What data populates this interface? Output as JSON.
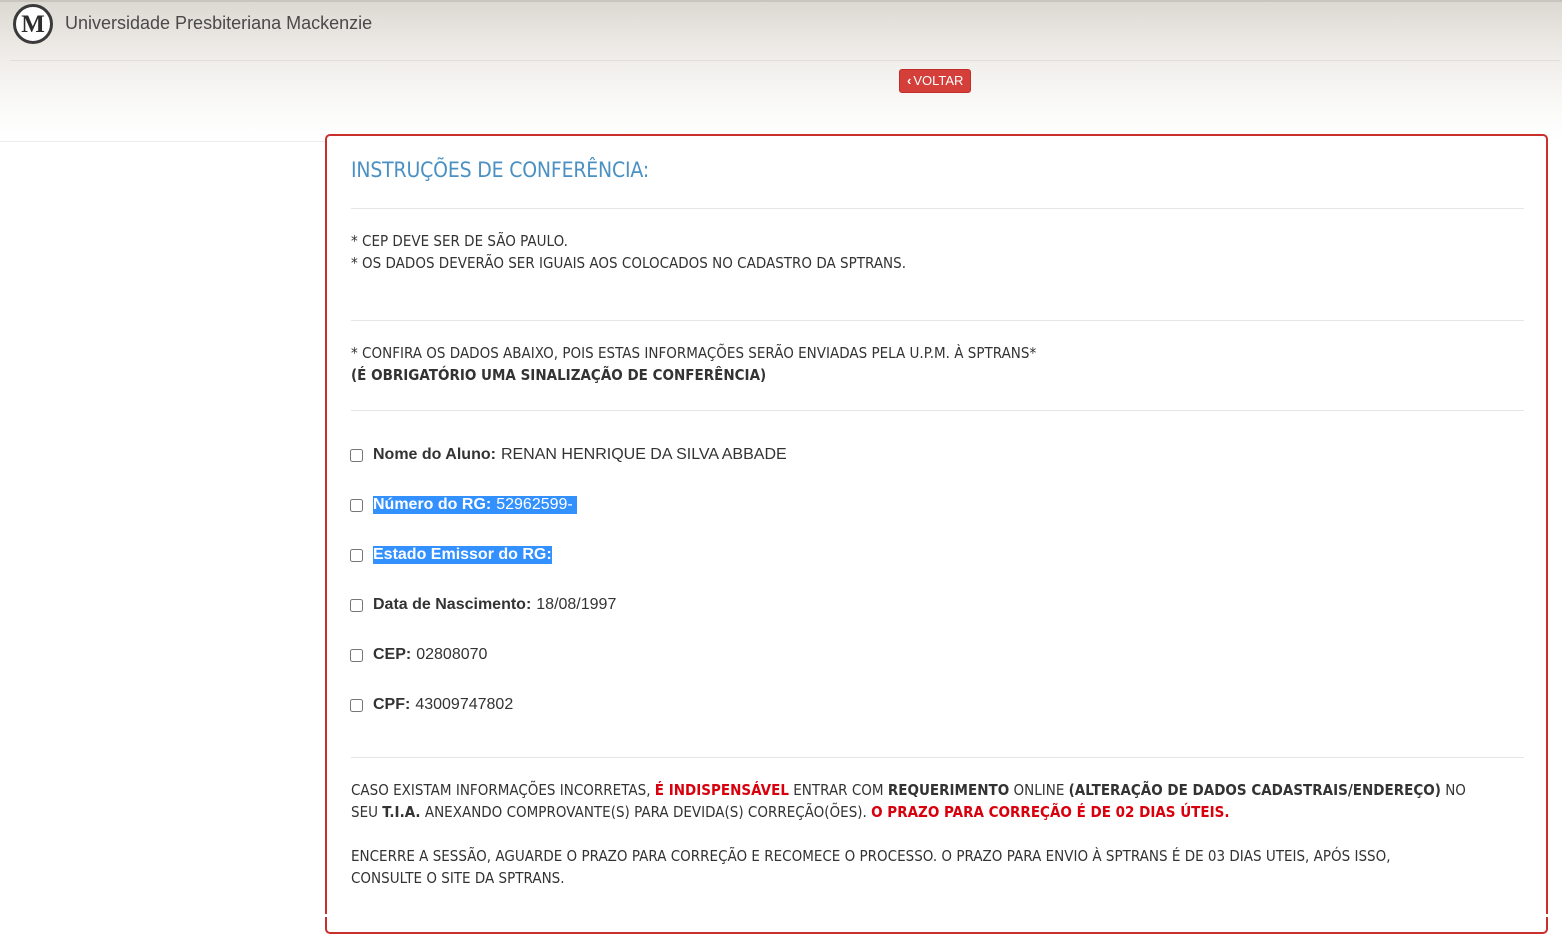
{
  "header": {
    "logo_letter": "M",
    "brand_name": "Universidade Presbiteriana Mackenzie",
    "back_label": "VOLTAR"
  },
  "panel": {
    "title": "INSTRUÇÕES DE CONFERÊNCIA:",
    "note1": "* CEP DEVE SER DE SÃO PAULO.",
    "note2": "* OS DADOS DEVERÃO SER IGUAIS AOS COLOCADOS NO CADASTRO DA SPTRANS.",
    "confirm_line": "* CONFIRA OS DADOS ABAIXO, POIS ESTAS INFORMAÇÕES SERÃO ENVIADAS PELA U.P.M. À SPTRANS*",
    "mandatory_line": "(É OBRIGATÓRIO UMA SINALIZAÇÃO DE CONFERÊNCIA)",
    "fields": [
      {
        "label": "Nome do Aluno:",
        "value": "RENAN HENRIQUE DA SILVA ABBADE"
      },
      {
        "label": "Número do RG:",
        "value": "52962599-"
      },
      {
        "label": "Estado Emissor do RG:",
        "value": ""
      },
      {
        "label": "Data de Nascimento:",
        "value": "18/08/1997"
      },
      {
        "label": "CEP:",
        "value": "02808070"
      },
      {
        "label": "CPF:",
        "value": "43009747802"
      }
    ],
    "warning": {
      "p1_a": "CASO EXISTAM INFORMAÇÕES INCORRETAS, ",
      "p1_b": "É INDISPENSÁVEL",
      "p1_c": " ENTRAR COM ",
      "p1_d": "REQUERIMENTO",
      "p1_e": " ONLINE ",
      "p1_f": "(ALTERAÇÃO DE DADOS CADASTRAIS/ENDEREÇO)",
      "p1_g": " NO",
      "p2_a": "SEU ",
      "p2_b": "T.I.A.",
      "p2_c": " ANEXANDO COMPROVANTE(S) PARA DEVIDA(S) CORREÇÃO(ÕES). ",
      "p2_d": "O PRAZO PARA CORREÇÃO É DE 02 DIAS ÚTEIS.",
      "p3": "ENCERRE A SESSÃO, AGUARDE O PRAZO PARA CORREÇÃO E RECOMECE O PROCESSO. O PRAZO PARA ENVIO À SPTRANS É DE 03 DIAS UTEIS, APÓS ISSO,",
      "p4": "CONSULTE O SITE DA SPTRANS."
    }
  },
  "colors": {
    "title_blue": "#4a90c2",
    "panel_border_red": "#c9302c",
    "button_red": "#d43f3a",
    "warning_red": "#d9000d",
    "selection_blue": "#3390ff"
  }
}
